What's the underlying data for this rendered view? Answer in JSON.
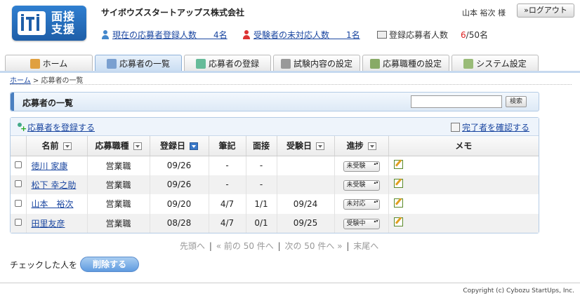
{
  "header": {
    "logo_text_line1": "面接",
    "logo_text_line2": "支援",
    "company": "サイボウズスタートアップス株式会社",
    "user_name": "山本 裕次 様",
    "logout_label": "»ログアウト",
    "stats": [
      {
        "label": "現在の応募者登録人数",
        "value": "4名"
      },
      {
        "label": "受験者の未対応人数",
        "value": "1名"
      },
      {
        "label": "登録応募者人数",
        "value_current": "6",
        "value_rest": "/50名"
      }
    ]
  },
  "tabs": [
    {
      "label": "ホーム",
      "icon": "home-icon",
      "color": "#e0a040"
    },
    {
      "label": "応募者の一覧",
      "icon": "users-icon",
      "color": "#7aa0d0",
      "active": true
    },
    {
      "label": "応募者の登録",
      "icon": "add-user-icon",
      "color": "#6b9"
    },
    {
      "label": "試験内容の設定",
      "icon": "clipboard-icon",
      "color": "#999"
    },
    {
      "label": "応募職種の設定",
      "icon": "book-icon",
      "color": "#8a6"
    },
    {
      "label": "システム設定",
      "icon": "wrench-icon",
      "color": "#9b7"
    }
  ],
  "breadcrumb": {
    "home": "ホーム",
    "sep": " > ",
    "current": "応募者の一覧"
  },
  "page": {
    "title": "応募者の一覧",
    "search_button": "検索",
    "add_link": "応募者を登録する",
    "done_link": "完了者を確認する"
  },
  "table": {
    "headers": [
      "名前",
      "応募職種",
      "登録日",
      "筆記",
      "面接",
      "受験日",
      "進捗",
      "メモ"
    ],
    "rows": [
      {
        "name": "徳川 家康",
        "job": "営業職",
        "date": "09/26",
        "written": "-",
        "interview": "-",
        "exam_date": "",
        "status": "未受験"
      },
      {
        "name": "松下 幸之助",
        "job": "営業職",
        "date": "09/26",
        "written": "-",
        "interview": "-",
        "exam_date": "",
        "status": "未受験"
      },
      {
        "name": "山本　裕次",
        "job": "営業職",
        "date": "09/20",
        "written": "4/7",
        "interview": "1/1",
        "exam_date": "09/24",
        "status": "未対応"
      },
      {
        "name": "田里友彦",
        "job": "営業職",
        "date": "08/28",
        "written": "4/7",
        "interview": "0/1",
        "exam_date": "09/25",
        "status": "受験中"
      }
    ]
  },
  "pager": {
    "first": "先頭へ",
    "prev": "« 前の 50 件へ",
    "next": "次の 50 件へ »",
    "last": "末尾へ",
    "sep": "|"
  },
  "footer": {
    "checked_label": "チェックした人を",
    "delete_label": "削除する",
    "copyright": "Copyright (c) Cybozu StartUps, Inc."
  }
}
